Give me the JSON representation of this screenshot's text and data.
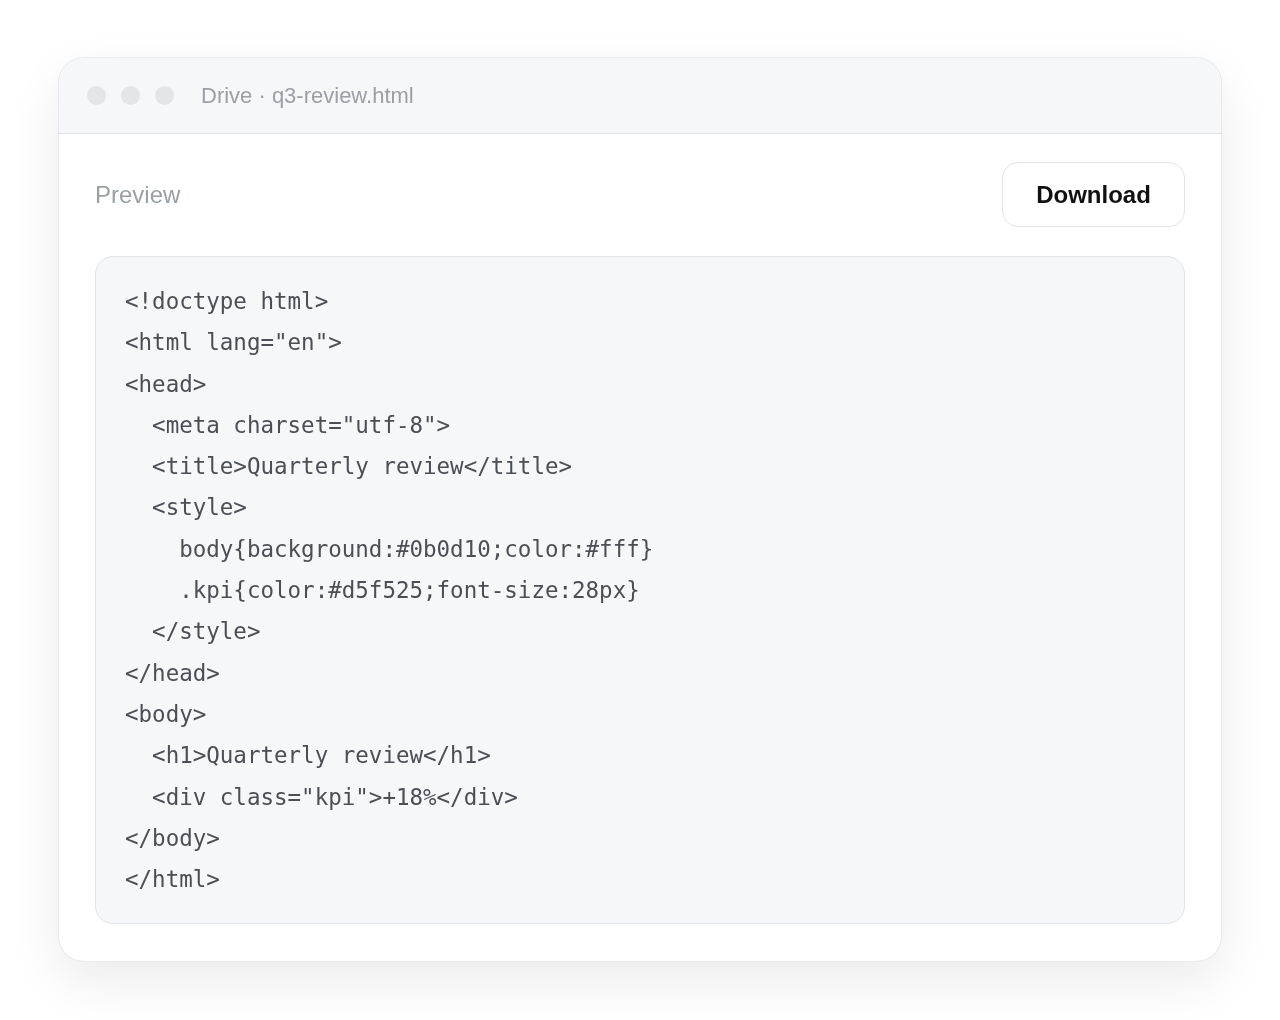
{
  "window": {
    "title": "Drive · q3-review.html"
  },
  "header": {
    "label": "Preview",
    "button": "Download"
  },
  "code_lines": [
    "<!doctype html>",
    "<html lang=\"en\">",
    "<head>",
    "  <meta charset=\"utf-8\">",
    "  <title>Quarterly review</title>",
    "  <style>",
    "    body{background:#0b0d10;color:#fff}",
    "    .kpi{color:#d5f525;font-size:28px}",
    "  </style>",
    "</head>",
    "<body>",
    "  <h1>Quarterly review</h1>",
    "  <div class=\"kpi\">+18%</div>",
    "</body>",
    "</html>"
  ]
}
